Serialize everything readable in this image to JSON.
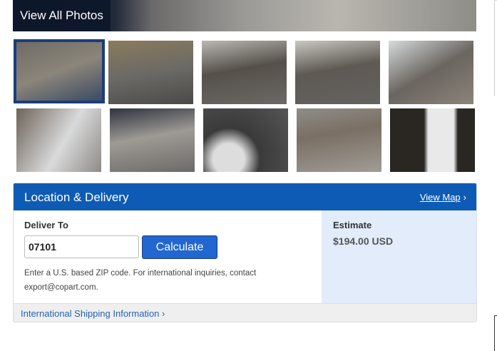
{
  "gallery": {
    "view_all_label": "View All Photos",
    "thumbnail_count": 10,
    "selected_index": 0
  },
  "location": {
    "title": "Location & Delivery",
    "view_map": "View Map",
    "chevron": "›",
    "deliver_to_label": "Deliver To",
    "zip_value": "07101",
    "calculate_label": "Calculate",
    "hint": "Enter a U.S. based ZIP code. For international inquiries, contact export@copart.com.",
    "estimate_label": "Estimate",
    "estimate_value": "$194.00 USD",
    "intl_link": "International Shipping Information",
    "intl_chevron": "›"
  },
  "colors": {
    "header": "#0e5bb5",
    "button": "#2167cf",
    "estimate_bg": "#e2ecfb"
  }
}
